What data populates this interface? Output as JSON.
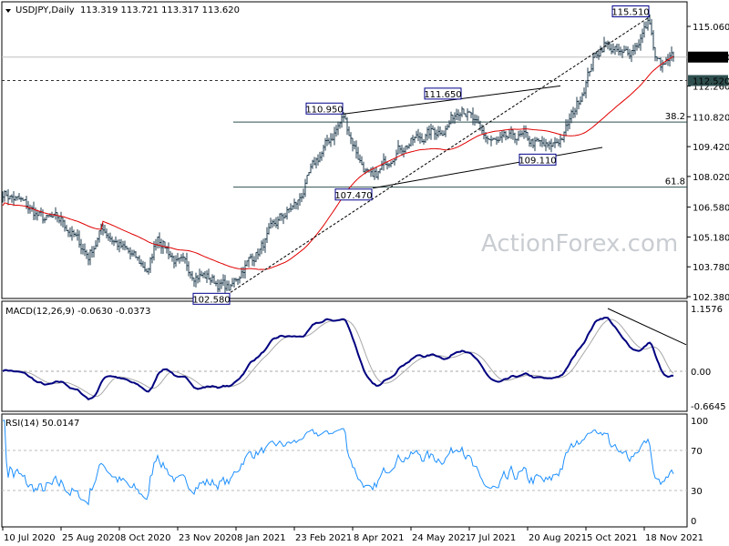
{
  "header": {
    "symbol": "USDJPY,Daily",
    "ohlc": "113.319 113.721 113.317 113.620"
  },
  "watermark": "ActionForex.com",
  "colors": {
    "bars": "#1f3b4d",
    "moving_average": "#e00000",
    "macd_line": "#000080",
    "signal_line": "#a8a8a8",
    "rsi_line": "#1e90ff",
    "current_price_tag": "#000000",
    "level_tag": "#2f4f4f"
  },
  "chart_data": [
    {
      "type": "ohlc-bar",
      "title": "USDJPY,Daily",
      "x_tick_labels": [
        "10 Jul 2020",
        "25 Aug 2020",
        "8 Oct 2020",
        "23 Nov 2020",
        "8 Jan 2021",
        "23 Feb 2021",
        "8 Apr 2021",
        "24 May 2021",
        "7 Jul 2021",
        "20 Aug 2021",
        "5 Oct 2021",
        "18 Nov 2021"
      ],
      "y_tick_labels": [
        "115.060",
        "112.260",
        "110.820",
        "109.420",
        "108.020",
        "106.580",
        "105.180",
        "103.780",
        "102.380"
      ],
      "ylim": [
        102.38,
        115.06
      ],
      "close_anchors": [
        {
          "bar": 0,
          "close": 107.3
        },
        {
          "bar": 10,
          "close": 106.8
        },
        {
          "bar": 22,
          "close": 106.0
        },
        {
          "bar": 33,
          "close": 105.9
        },
        {
          "bar": 47,
          "close": 104.3
        },
        {
          "bar": 55,
          "close": 105.6
        },
        {
          "bar": 66,
          "close": 104.6
        },
        {
          "bar": 80,
          "close": 103.6
        },
        {
          "bar": 85,
          "close": 105.3
        },
        {
          "bar": 96,
          "close": 103.9
        },
        {
          "bar": 112,
          "close": 103.3
        },
        {
          "bar": 125,
          "close": 102.7
        },
        {
          "bar": 132,
          "close": 103.8
        },
        {
          "bar": 142,
          "close": 104.7
        },
        {
          "bar": 152,
          "close": 106.0
        },
        {
          "bar": 162,
          "close": 106.8
        },
        {
          "bar": 172,
          "close": 108.7
        },
        {
          "bar": 187,
          "close": 110.8
        },
        {
          "bar": 196,
          "close": 108.8
        },
        {
          "bar": 203,
          "close": 107.7
        },
        {
          "bar": 215,
          "close": 109.3
        },
        {
          "bar": 228,
          "close": 109.8
        },
        {
          "bar": 244,
          "close": 110.4
        },
        {
          "bar": 252,
          "close": 111.5
        },
        {
          "bar": 262,
          "close": 110.0
        },
        {
          "bar": 272,
          "close": 109.5
        },
        {
          "bar": 282,
          "close": 109.9
        },
        {
          "bar": 300,
          "close": 109.3
        },
        {
          "bar": 308,
          "close": 110.0
        },
        {
          "bar": 316,
          "close": 111.6
        },
        {
          "bar": 324,
          "close": 113.5
        },
        {
          "bar": 330,
          "close": 114.3
        },
        {
          "bar": 340,
          "close": 113.6
        },
        {
          "bar": 348,
          "close": 114.3
        },
        {
          "bar": 355,
          "close": 115.3
        },
        {
          "bar": 358,
          "close": 113.5
        },
        {
          "bar": 362,
          "close": 113.1
        },
        {
          "bar": 368,
          "close": 113.62
        }
      ],
      "moving_average": {
        "color": "#e00000"
      },
      "current_price": 113.62,
      "horizontal_level": 112.52,
      "fibonacci": [
        {
          "label": "38.2",
          "price": 110.57
        },
        {
          "label": "61.8",
          "price": 107.52
        }
      ],
      "annotations": [
        {
          "label": "115.510",
          "bar": 355,
          "price": 115.51
        },
        {
          "label": "111.650",
          "bar": 252,
          "price": 111.65
        },
        {
          "label": "110.950",
          "bar": 187,
          "price": 110.95
        },
        {
          "label": "109.110",
          "bar": 304,
          "price": 109.11
        },
        {
          "label": "107.470",
          "bar": 203,
          "price": 107.47
        },
        {
          "label": "102.580",
          "bar": 125,
          "price": 102.58
        }
      ],
      "trendlines": [
        {
          "style": "dashed",
          "from": {
            "bar": 125,
            "price": 102.58
          },
          "to": {
            "bar": 355,
            "price": 115.51
          }
        },
        {
          "style": "solid",
          "from": {
            "bar": 187,
            "price": 110.95
          },
          "to": {
            "bar": 306,
            "price": 112.27
          }
        },
        {
          "style": "solid",
          "from": {
            "bar": 203,
            "price": 107.47
          },
          "to": {
            "bar": 329,
            "price": 109.38
          }
        }
      ]
    },
    {
      "type": "line",
      "title": "MACD(12,26,9) -0.0630 -0.0373",
      "label": "MACD(12,26,9)",
      "values_printed": [
        "-0.0630",
        "-0.0373"
      ],
      "y_tick_labels": [
        "1.1576",
        "0.00",
        "-0.6645"
      ],
      "ylim": [
        -0.6645,
        1.1576
      ],
      "params": [
        12,
        26,
        9
      ],
      "trendline": {
        "from": {
          "bar": 332,
          "value": 1.1576
        },
        "to": {
          "bar": 375,
          "value": 0.49
        }
      }
    },
    {
      "type": "line",
      "title": "RSI(14) 50.0147",
      "label": "RSI(14)",
      "value_printed": "50.0147",
      "y_tick_labels": [
        "100",
        "70",
        "30",
        "0"
      ],
      "ylim": [
        0,
        100
      ],
      "levels": [
        70,
        30
      ],
      "period": 14
    }
  ]
}
